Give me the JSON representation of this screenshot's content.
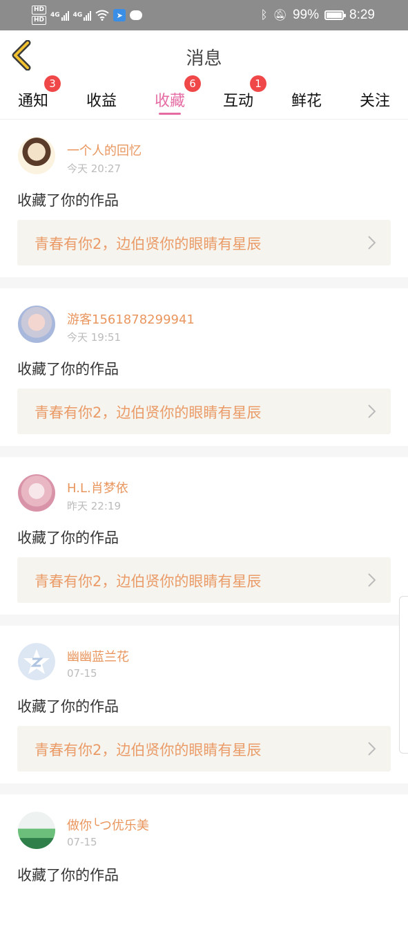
{
  "status_bar": {
    "hd1": "HD",
    "hd2": "HD",
    "net1": "4G",
    "net2": "4G",
    "battery_pct": "99%",
    "time": "8:29"
  },
  "header": {
    "title": "消息"
  },
  "tabs": [
    {
      "label": "通知",
      "badge": "3"
    },
    {
      "label": "收益",
      "badge": ""
    },
    {
      "label": "收藏",
      "badge": "6",
      "active": true
    },
    {
      "label": "互动",
      "badge": "1"
    },
    {
      "label": "鲜花",
      "badge": ""
    },
    {
      "label": "关注",
      "badge": ""
    }
  ],
  "feed": [
    {
      "user": "一个人的回忆",
      "time": "今天 20:27",
      "action": "收藏了你的作品",
      "work": "青春有你2，边伯贤你的眼睛有星辰"
    },
    {
      "user": "游客1561878299941",
      "time": "今天 19:51",
      "action": "收藏了你的作品",
      "work": "青春有你2，边伯贤你的眼睛有星辰"
    },
    {
      "user": "H.L.肖梦依",
      "time": "昨天 22:19",
      "action": "收藏了你的作品",
      "work": "青春有你2，边伯贤你的眼睛有星辰"
    },
    {
      "user": "幽幽蓝兰花",
      "time": "07-15",
      "action": "收藏了你的作品",
      "work": "青春有你2，边伯贤你的眼睛有星辰"
    },
    {
      "user": "做你╰つ优乐美",
      "time": "07-15",
      "action": "收藏了你的作品",
      "work": ""
    }
  ],
  "colors": {
    "accent_pink": "#e56ba3",
    "username_orange": "#e9965e",
    "badge_red": "#f04848",
    "work_bg": "#f5f4ee",
    "back_arrow_yellow": "#f2c230"
  }
}
